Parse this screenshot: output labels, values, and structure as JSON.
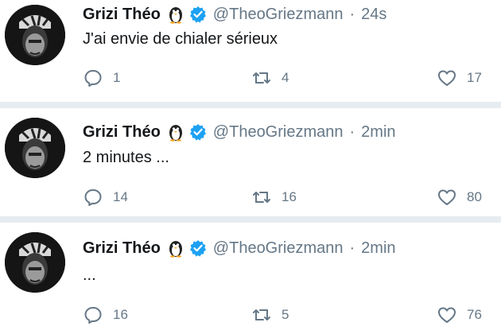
{
  "tweets": [
    {
      "display_name": "Grizi Théo",
      "handle": "@TheoGriezmann",
      "separator": "·",
      "time": "24s",
      "text": "J'ai envie de chialer sérieux",
      "replies": "1",
      "retweets": "4",
      "likes": "17"
    },
    {
      "display_name": "Grizi Théo",
      "handle": "@TheoGriezmann",
      "separator": "·",
      "time": "2min",
      "text": "2 minutes ...",
      "replies": "14",
      "retweets": "16",
      "likes": "80"
    },
    {
      "display_name": "Grizi Théo",
      "handle": "@TheoGriezmann",
      "separator": "·",
      "time": "2min",
      "text": "...",
      "replies": "16",
      "retweets": "5",
      "likes": "76"
    }
  ],
  "icons": {
    "reply": "reply-icon",
    "retweet": "retweet-icon",
    "like": "heart-icon",
    "verified": "verified-badge-icon",
    "emoji": "penguin-emoji-icon"
  },
  "colors": {
    "verified": "#1da1f2",
    "secondary_text": "#657786",
    "divider": "#e6ecf0"
  }
}
